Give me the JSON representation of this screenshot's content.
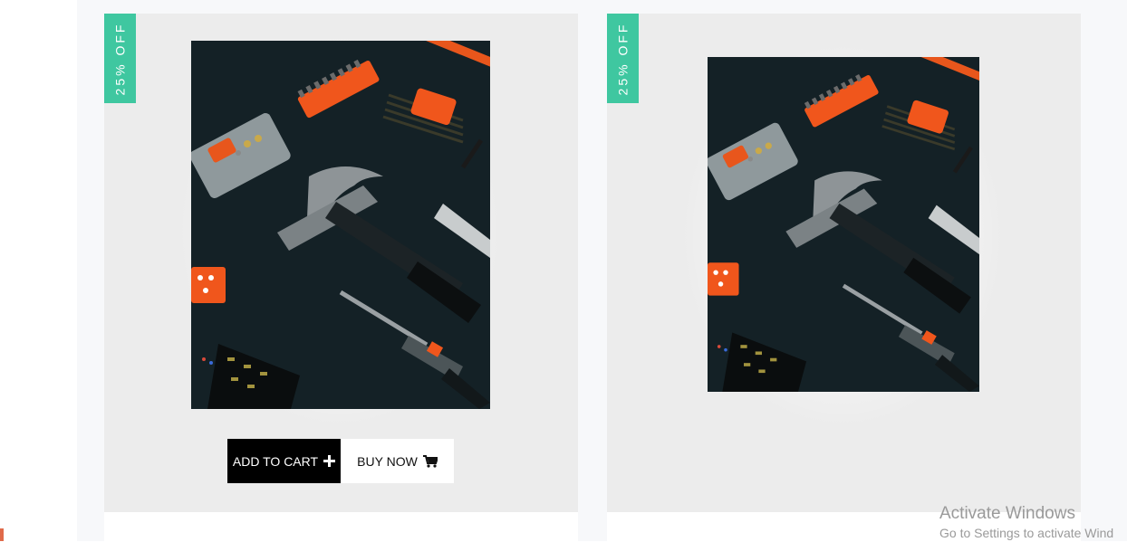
{
  "products": [
    {
      "badge": "25% OFF",
      "image": "tools-flatlay-image",
      "actions": {
        "add_to_cart": "ADD TO CART",
        "buy_now": "BUY NOW"
      }
    },
    {
      "badge": "25% OFF",
      "image": "tools-flatlay-image"
    }
  ],
  "icons": {
    "add": "plus-icon",
    "buy": "cart-icon"
  },
  "colors": {
    "badge": "#3fc7a0",
    "card": "#ececec",
    "cart_button": "#000000",
    "buy_button": "#ffffff"
  },
  "watermark": {
    "title": "Activate Windows",
    "subtitle": "Go to Settings to activate Wind"
  }
}
